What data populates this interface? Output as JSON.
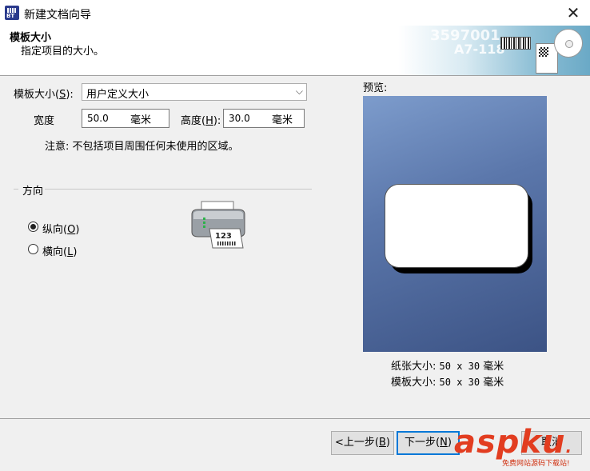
{
  "window": {
    "title": "新建文档向导",
    "close_glyph": "✕"
  },
  "app_icon_text": "BT",
  "header": {
    "title": "模板大小",
    "subtitle": "指定项目的大小。",
    "art_text_1": "3597001",
    "art_text_2": "A7-118"
  },
  "form": {
    "template_size_label": "模板大小(",
    "template_size_key": "S",
    "template_size_label_end": "):",
    "template_size_value": "用户定义大小",
    "width_label": "宽度",
    "width_value": "50.0",
    "width_unit": "毫米",
    "height_label": "高度(",
    "height_key": "H",
    "height_label_end": "):",
    "height_value": "30.0",
    "height_unit": "毫米",
    "note": "注意: 不包括项目周围任何未使用的区域。"
  },
  "orientation": {
    "group_label": "方向",
    "portrait_label": "纵向(",
    "portrait_key": "O",
    "portrait_end": ")",
    "portrait_selected": true,
    "landscape_label": "横向(",
    "landscape_key": "L",
    "landscape_end": ")",
    "landscape_selected": false,
    "printer_label_text": "123"
  },
  "preview": {
    "label": "预览:",
    "paper_size_label": "纸张大小:",
    "paper_size_value": "50 x 30",
    "paper_size_unit": "毫米",
    "template_size_label": "模板大小:",
    "template_size_value": "50 x 30",
    "template_size_unit": "毫米"
  },
  "buttons": {
    "back": "<上一步(",
    "back_key": "B",
    "back_end": ")",
    "next": "下一步(",
    "next_key": "N",
    "next_end": ")",
    "cancel": "取消"
  },
  "watermark": {
    "main": "aspku",
    "dot": ".",
    "sub": "免费网站源码下载站!"
  },
  "colors": {
    "preview_top": "#7d9ccc",
    "preview_bottom": "#3c5385",
    "default_button_border": "#0078d7",
    "watermark": "#e23d20"
  }
}
